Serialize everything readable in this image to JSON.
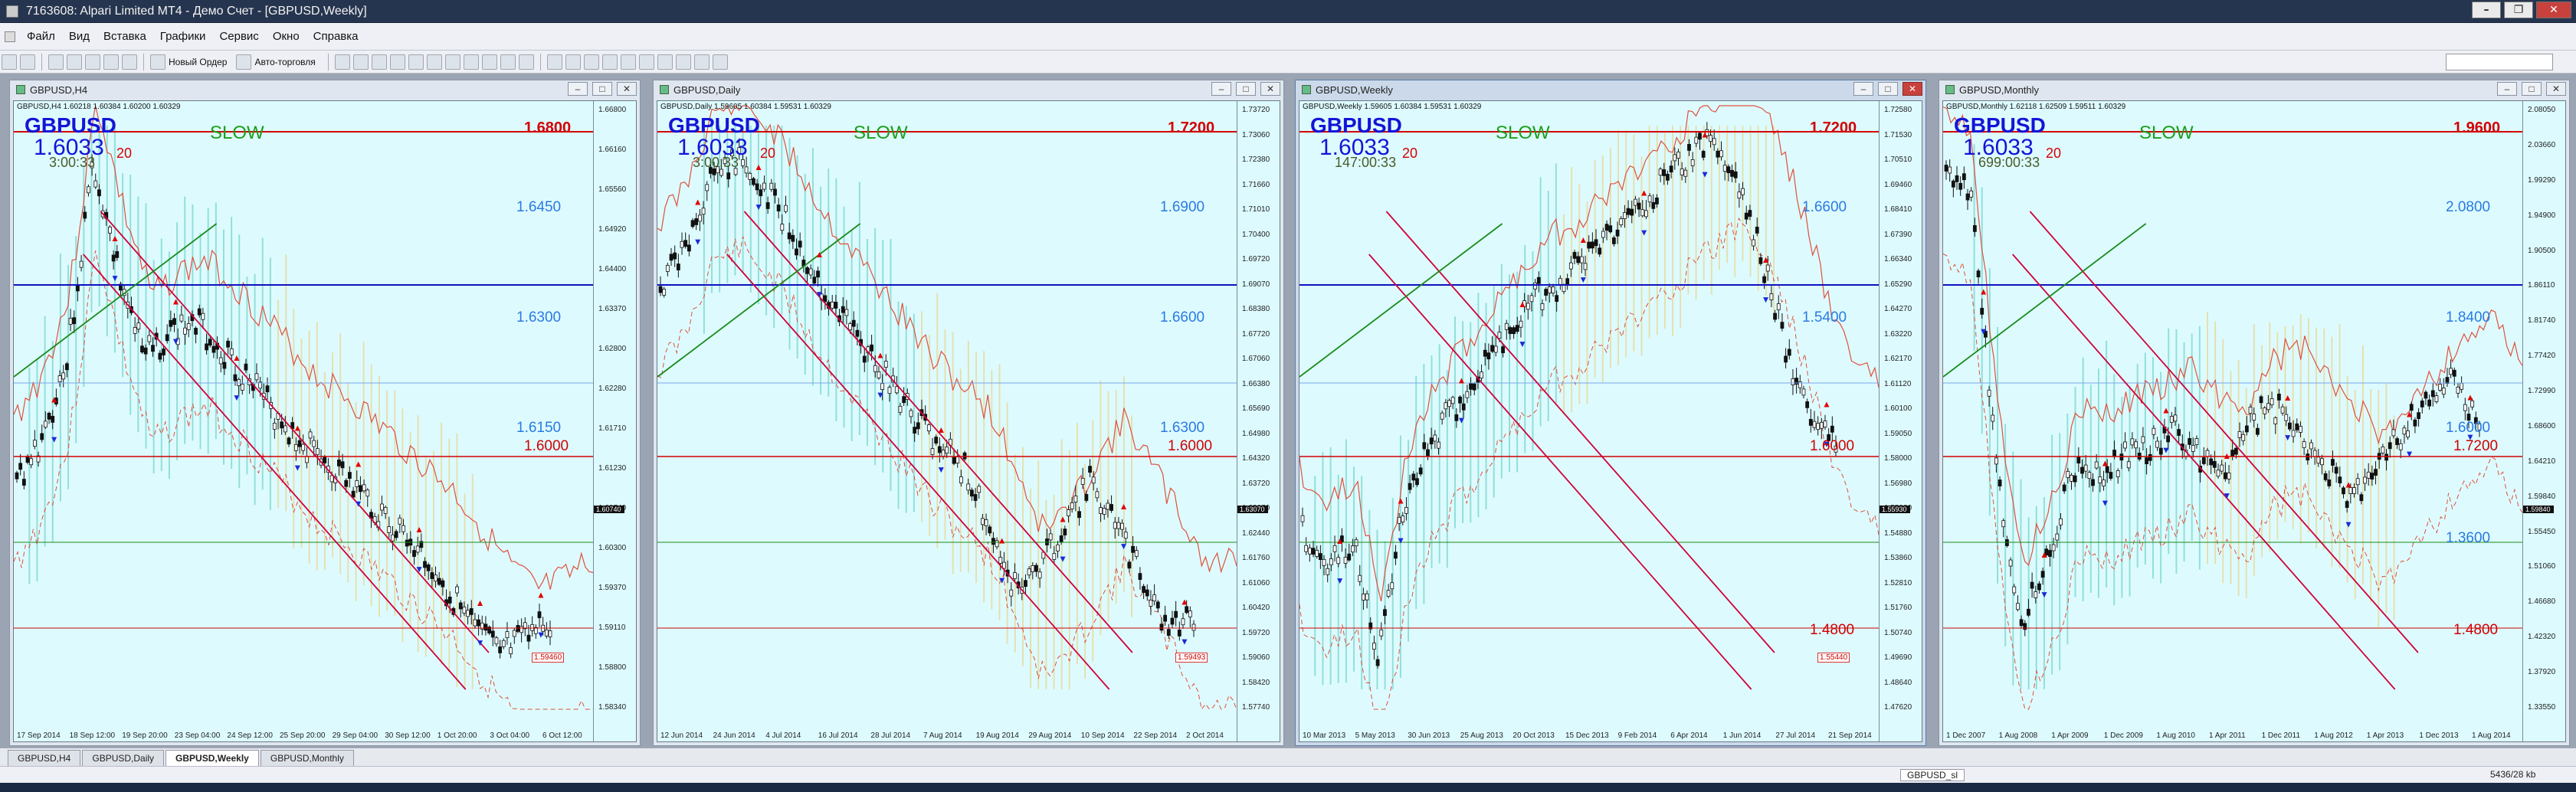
{
  "title": "7163608: Alpari Limited MT4 - Демо Счет - [GBPUSD,Weekly]",
  "menu": [
    "Файл",
    "Вид",
    "Вставка",
    "Графики",
    "Сервис",
    "Окно",
    "Справка"
  ],
  "toolbar": {
    "new_order": "Новый Ордер",
    "auto_trade": "Авто-торговля"
  },
  "charts": [
    {
      "title": "GBPUSD,H4",
      "ohlc": "GBPUSD,H4  1.60218 1.60384 1.60200 1.60329",
      "symbol": "GBPUSD",
      "price": "1.6033",
      "spread": "20",
      "timer": "3:00:33",
      "mode": "SLOW",
      "yaxis": [
        "1.66800",
        "1.66160",
        "1.65560",
        "1.64920",
        "1.64400",
        "1.63370",
        "1.62800",
        "1.62280",
        "1.61710",
        "1.61230",
        "1.60740",
        "1.60300",
        "1.59370",
        "1.59110",
        "1.58800",
        "1.58340"
      ],
      "xaxis": [
        "17 Sep 2014",
        "18 Sep 12:00",
        "19 Sep 20:00",
        "23 Sep 04:00",
        "24 Sep 12:00",
        "25 Sep 20:00",
        "29 Sep 04:00",
        "30 Sep 12:00",
        "1 Oct 20:00",
        "3 Oct 04:00",
        "6 Oct 12:00"
      ],
      "levels_red": [
        "1.6800",
        "1.6000"
      ],
      "levels_blue": [
        "1.6450",
        "1.6300",
        "1.6150"
      ],
      "tag": "1.59460"
    },
    {
      "title": "GBPUSD,Daily",
      "ohlc": "GBPUSD,Daily  1.59605 1.60384 1.59531 1.60329",
      "symbol": "GBPUSD",
      "price": "1.6033",
      "spread": "20",
      "timer": "3:00:33",
      "mode": "SLOW",
      "yaxis": [
        "1.73720",
        "1.73060",
        "1.72380",
        "1.71660",
        "1.71010",
        "1.70400",
        "1.69720",
        "1.69070",
        "1.68380",
        "1.67720",
        "1.67060",
        "1.66380",
        "1.65690",
        "1.64980",
        "1.64320",
        "1.63720",
        "1.63070",
        "1.62440",
        "1.61760",
        "1.61060",
        "1.60420",
        "1.59720",
        "1.59060",
        "1.58420",
        "1.57740"
      ],
      "xaxis": [
        "12 Jun 2014",
        "24 Jun 2014",
        "4 Jul 2014",
        "16 Jul 2014",
        "28 Jul 2014",
        "7 Aug 2014",
        "19 Aug 2014",
        "29 Aug 2014",
        "10 Sep 2014",
        "22 Sep 2014",
        "2 Oct 2014"
      ],
      "levels_red": [
        "1.7200",
        "1.6000"
      ],
      "levels_blue": [
        "1.6900",
        "1.6600",
        "1.6300"
      ],
      "tag": "1.59493"
    },
    {
      "title": "GBPUSD,Weekly",
      "ohlc": "GBPUSD,Weekly  1.59605 1.60384 1.59531 1.60329",
      "symbol": "GBPUSD",
      "price": "1.6033",
      "spread": "20",
      "timer": "147:00:33",
      "mode": "SLOW",
      "yaxis": [
        "1.72580",
        "1.71530",
        "1.70510",
        "1.69460",
        "1.68410",
        "1.67390",
        "1.66340",
        "1.65290",
        "1.64270",
        "1.63220",
        "1.62170",
        "1.61120",
        "1.60100",
        "1.59050",
        "1.58000",
        "1.56980",
        "1.55930",
        "1.54880",
        "1.53860",
        "1.52810",
        "1.51760",
        "1.50740",
        "1.49690",
        "1.48640",
        "1.47620"
      ],
      "xaxis": [
        "10 Mar 2013",
        "5 May 2013",
        "30 Jun 2013",
        "25 Aug 2013",
        "20 Oct 2013",
        "15 Dec 2013",
        "9 Feb 2014",
        "6 Apr 2014",
        "1 Jun 2014",
        "27 Jul 2014",
        "21 Sep 2014"
      ],
      "levels_red": [
        "1.7200",
        "1.6000",
        "1.4800"
      ],
      "levels_blue": [
        "1.6600",
        "1.5400"
      ],
      "tag": "1.55440"
    },
    {
      "title": "GBPUSD,Monthly",
      "ohlc": "GBPUSD,Monthly  1.62118 1.62509 1.59511 1.60329",
      "symbol": "GBPUSD",
      "price": "1.6033",
      "spread": "20",
      "timer": "699:00:33",
      "mode": "SLOW",
      "yaxis": [
        "2.08050",
        "2.03660",
        "1.99290",
        "1.94900",
        "1.90500",
        "1.86110",
        "1.81740",
        "1.77420",
        "1.72990",
        "1.68600",
        "1.64210",
        "1.59840",
        "1.55450",
        "1.51060",
        "1.46680",
        "1.42320",
        "1.37920",
        "1.33550"
      ],
      "xaxis": [
        "1 Dec 2007",
        "1 Aug 2008",
        "1 Apr 2009",
        "1 Dec 2009",
        "1 Aug 2010",
        "1 Apr 2011",
        "1 Dec 2011",
        "1 Aug 2012",
        "1 Apr 2013",
        "1 Dec 2013",
        "1 Aug 2014"
      ],
      "levels_red": [
        "1.9600",
        "1.7200",
        "1.4800"
      ],
      "levels_blue": [
        "2.0800",
        "1.8400",
        "1.6000",
        "1.3600"
      ],
      "tag": ""
    }
  ],
  "tabs": [
    "GBPUSD,H4",
    "GBPUSD,Daily",
    "GBPUSD,Weekly",
    "GBPUSD,Monthly"
  ],
  "status": {
    "tpl": "GBPUSD_sl",
    "traffic": "5436/28 kb"
  },
  "colors": {
    "bg": "#ddfbff",
    "up": "#6fd3c8",
    "down": "#e5d49a",
    "level_red": "#d20000",
    "level_blue": "#2a7ae2"
  }
}
